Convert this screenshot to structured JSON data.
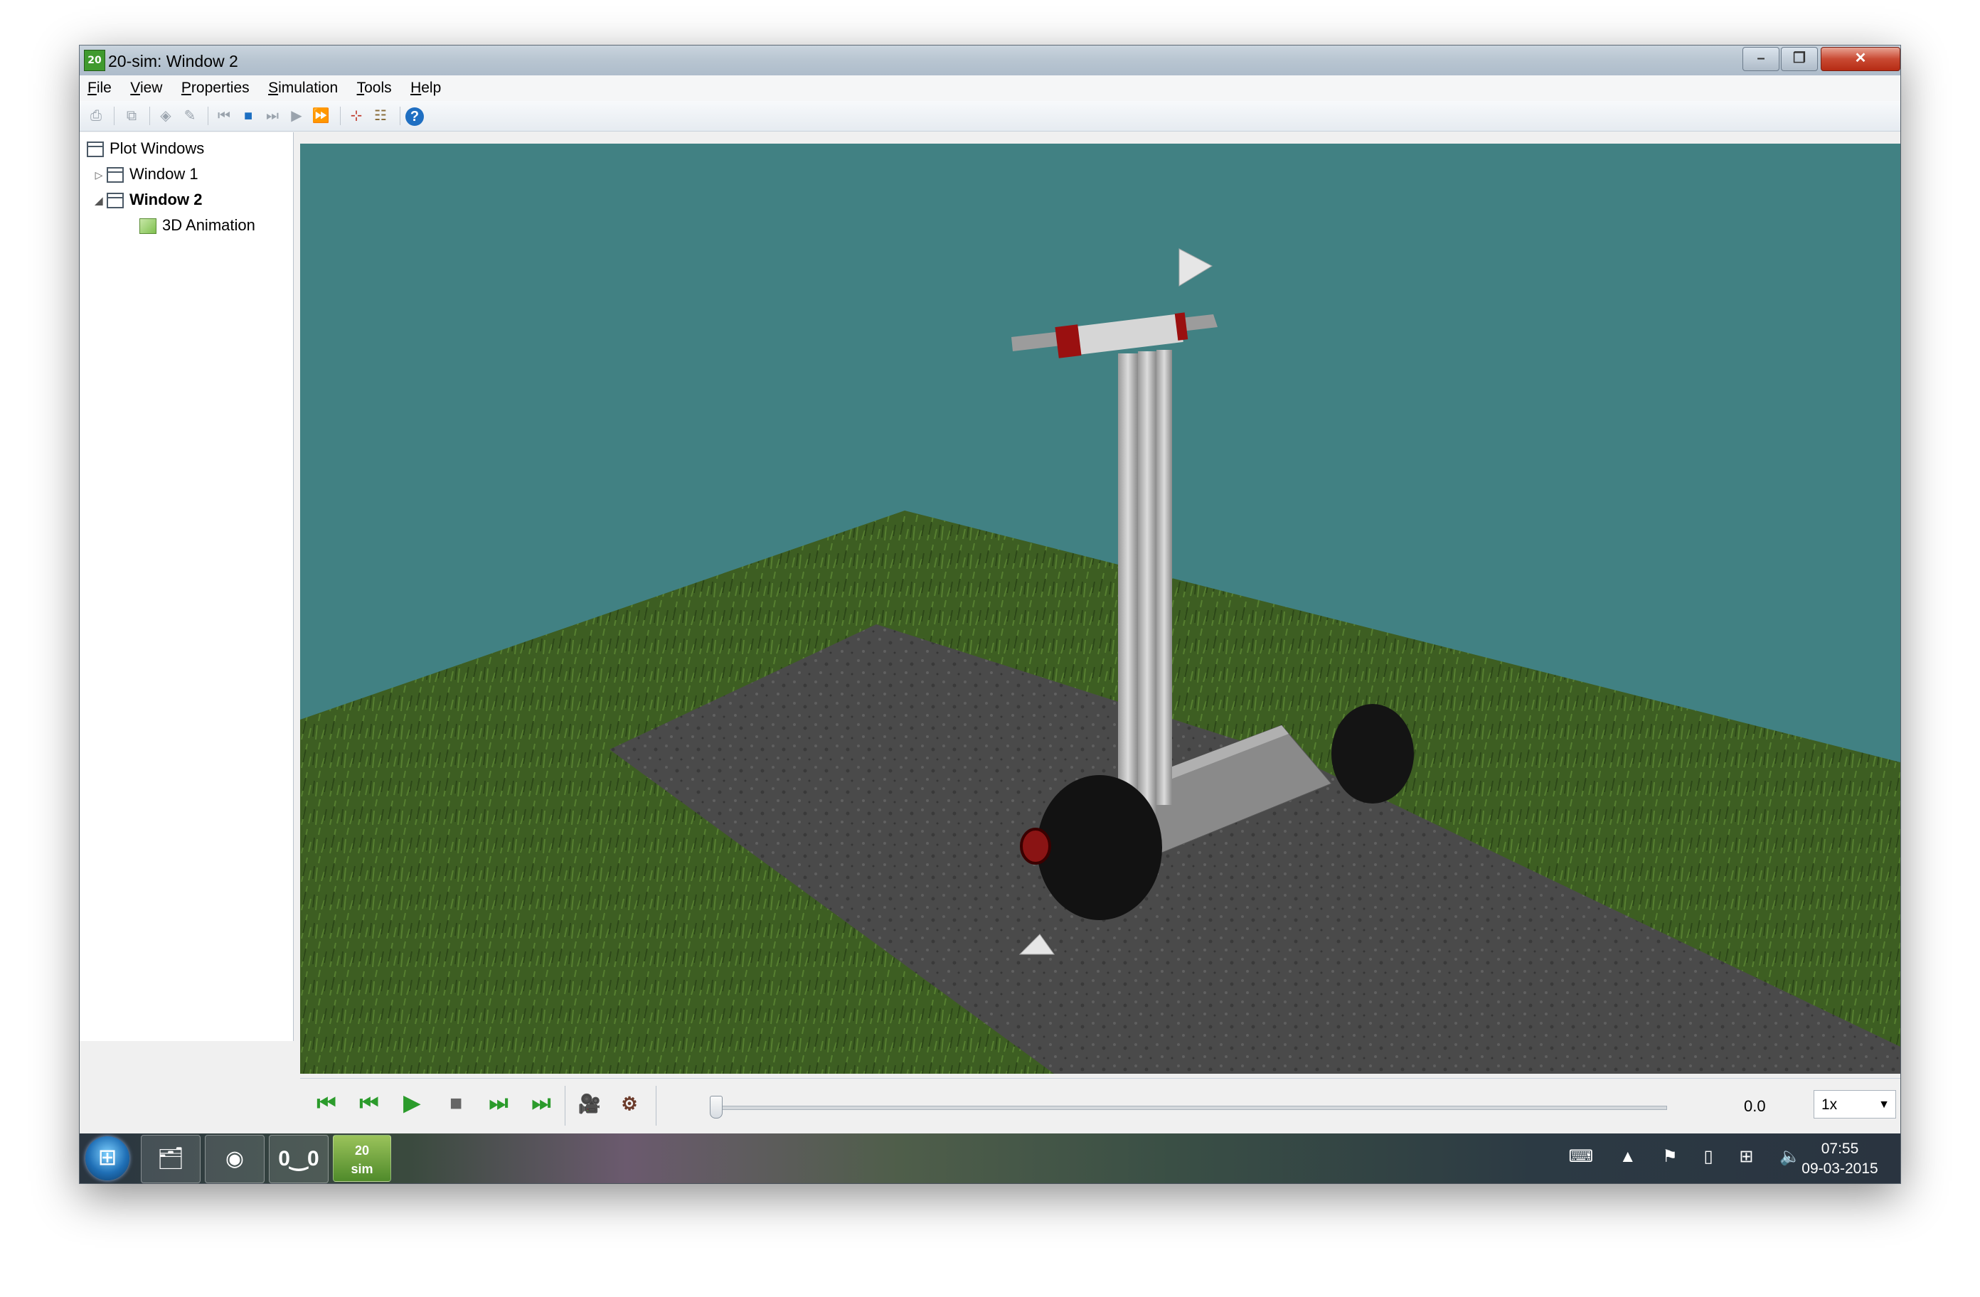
{
  "window": {
    "title": "20-sim: Window 2"
  },
  "menu": [
    "File",
    "View",
    "Properties",
    "Simulation",
    "Tools",
    "Help"
  ],
  "tree": {
    "root": "Plot Windows",
    "window1": "Window 1",
    "window2": "Window 2",
    "animation": "3D Animation"
  },
  "player": {
    "time": "0.0",
    "speed": "1x"
  },
  "taskbar": {
    "time": "07:55",
    "date": "09-03-2015",
    "app_20sim": "20\nsim"
  },
  "colors": {
    "sky": "#418183",
    "grass": "#3d5e22",
    "asphalt": "#4a4a4a",
    "accent_green": "#2b9b2b"
  }
}
